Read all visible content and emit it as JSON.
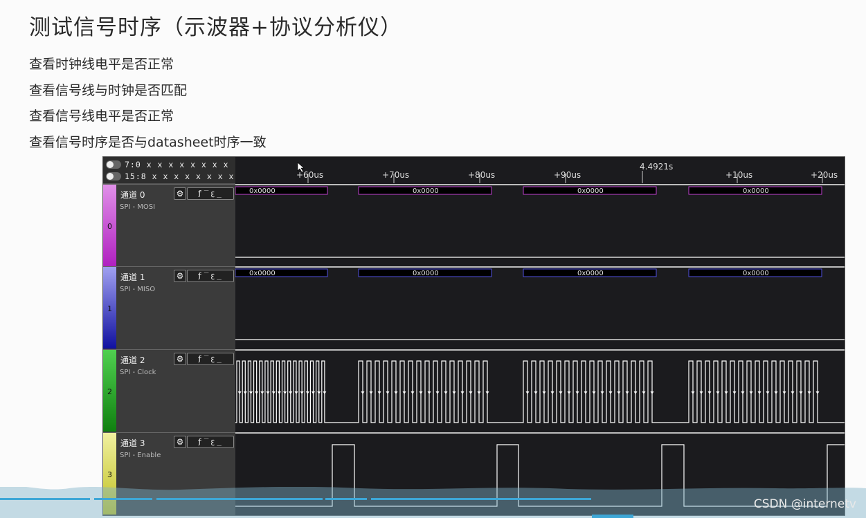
{
  "slide": {
    "title": "测试信号时序（示波器+协议分析仪）",
    "bullets": [
      "查看时钟线电平是否正常",
      "查看信号线与时钟是否匹配",
      "查看信号线电平是否正常",
      "查看信号时序是否与datasheet时序一致"
    ]
  },
  "analyzer": {
    "bits_high": "7:0  x x x x x x x x",
    "bits_low": "15:8  x x x x x x x x",
    "cursor_time": "4.4921s",
    "time_labels": [
      "+60us",
      "+70us",
      "+80us",
      "+90us",
      "+10us",
      "+20us"
    ],
    "channels": [
      {
        "num": "0",
        "name": "通道 0",
        "protocol": "SPI - MOSI",
        "color": "#c040d0"
      },
      {
        "num": "1",
        "name": "通道 1",
        "protocol": "SPI - MISO",
        "color": "#5050e0"
      },
      {
        "num": "2",
        "name": "通道 2",
        "protocol": "SPI - Clock",
        "color": "#30b030"
      },
      {
        "num": "3",
        "name": "通道 3",
        "protocol": "SPI - Enable",
        "color": "#e0e050"
      }
    ],
    "gear_glyph": "⚙",
    "trigger_glyphs": "ƒ‾ꜫ_",
    "decoded_value": "0x0000"
  },
  "watermark": "CSDN @internetv"
}
